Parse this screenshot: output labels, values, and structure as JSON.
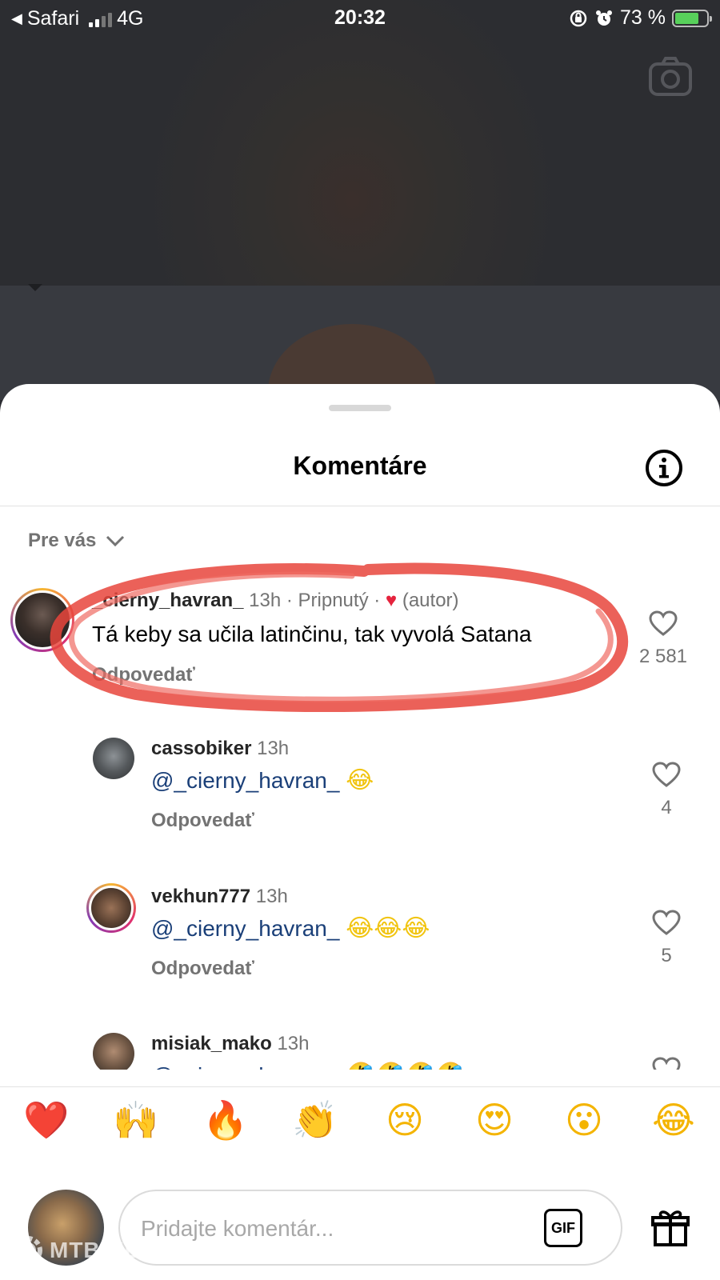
{
  "status_bar": {
    "back_label": "Safari",
    "network": "4G",
    "time": "20:32",
    "battery": "73 %"
  },
  "sheet": {
    "title": "Komentáre",
    "sort_label": "Pre vás"
  },
  "comments": [
    {
      "username": "_cierny_havran_",
      "time": "13h",
      "pinned": "Pripnutý",
      "author_tag": "(autor)",
      "text": "Tá keby sa učila latinčinu, tak vyvolá Satana",
      "reply_label": "Odpovedať",
      "likes": "2 581"
    },
    {
      "username": "cassobiker",
      "time": "13h",
      "mention": "@_cierny_havran_",
      "emoji": "😂",
      "reply_label": "Odpovedať",
      "likes": "4"
    },
    {
      "username": "vekhun777",
      "time": "13h",
      "mention": "@_cierny_havran_",
      "emoji": "😂😂😂",
      "reply_label": "Odpovedať",
      "likes": "5"
    },
    {
      "username": "misiak_mako",
      "time": "13h",
      "mention": "@_cierny_havran_",
      "emoji": "🤣🤣🤣🤣"
    }
  ],
  "reactions": [
    "❤️",
    "🙌",
    "🔥",
    "👏",
    "😢",
    "😍",
    "😮",
    "😂"
  ],
  "composer": {
    "placeholder": "Pridajte komentár...",
    "gif_label": "GIF"
  },
  "watermark": "MTBIKER",
  "colors": {
    "annotation": "#e8453c",
    "mention": "#1a3f78",
    "battery": "#58d05b"
  }
}
